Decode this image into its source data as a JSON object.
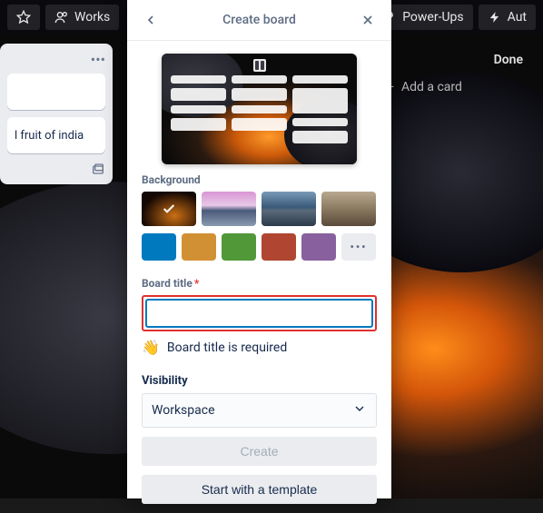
{
  "topbar": {
    "workspaces": "Works",
    "powerups": "Power-Ups",
    "automation": "Aut"
  },
  "list": {
    "card2_text": "l fruit of india"
  },
  "done": {
    "title": "Done",
    "add_card": "Add a card"
  },
  "dialog": {
    "title": "Create board",
    "background_label": "Background",
    "colors": [
      "#0079bf",
      "#d29034",
      "#519839",
      "#b04632",
      "#89609e"
    ],
    "title_label": "Board title",
    "title_value": "",
    "hint": "Board title is required",
    "visibility_label": "Visibility",
    "visibility_value": "Workspace",
    "create_btn": "Create",
    "template_btn": "Start with a template",
    "more": "…"
  }
}
